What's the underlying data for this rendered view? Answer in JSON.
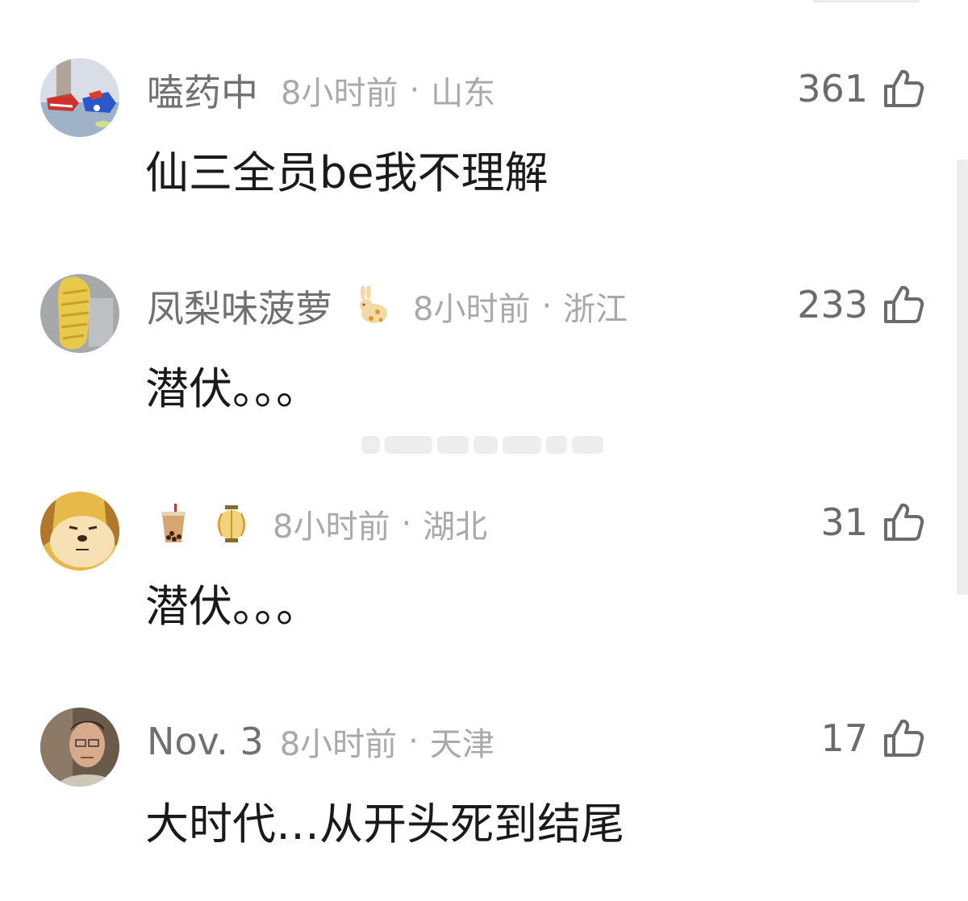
{
  "comments": [
    {
      "username": "嗑药中",
      "time": "8小时前",
      "dot": "·",
      "region": "山东",
      "likes": "361",
      "content": "仙三全员be我不理解",
      "avatar": "sneakers-photo-avatar"
    },
    {
      "username": "凤梨味菠萝",
      "badge_icon": "rabbit-icon",
      "time": "8小时前",
      "dot": "·",
      "region": "浙江",
      "likes": "233",
      "content": "潜伏。。。",
      "avatar": "pineapple-bread-avatar"
    },
    {
      "username_icons": [
        "bubble-tea-icon",
        "lantern-icon"
      ],
      "time": "8小时前",
      "dot": "·",
      "region": "湖北",
      "likes": "31",
      "content": "潜伏。。。",
      "avatar": "yellow-dog-avatar"
    },
    {
      "username": "Nov. 3",
      "time": "8小时前",
      "dot": "·",
      "region": "天津",
      "likes": "17",
      "content": "大时代…从开头死到结尾",
      "avatar": "man-photo-avatar"
    }
  ],
  "colors": {
    "username": "#707070",
    "meta": "#a9a9a9",
    "content": "#1a1a1a",
    "likes": "#6b6b6b"
  }
}
